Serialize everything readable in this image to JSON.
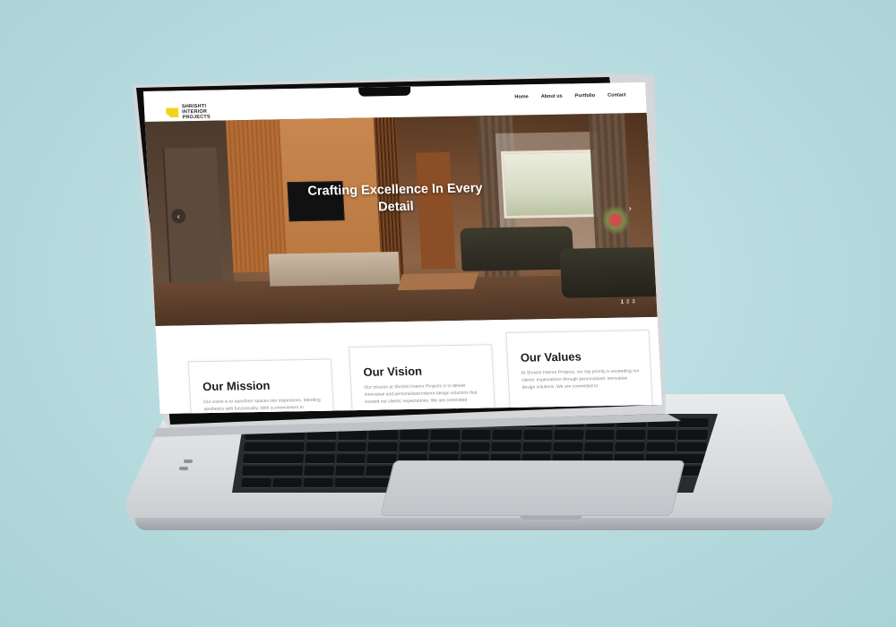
{
  "site": {
    "logo": {
      "line1": "SHRISHTI",
      "line2": "INTERIOR PROJECTS"
    },
    "nav": [
      "Home",
      "About us",
      "Portfolio",
      "Contact"
    ]
  },
  "hero": {
    "title": "Crafting Excellence In Every Detail",
    "prev_arrow": "‹",
    "next_arrow": "›",
    "dots": [
      "1",
      "2",
      "3"
    ]
  },
  "cards": [
    {
      "title": "Our Mission",
      "text": "Our vision is to transform spaces into inspirations, blending aesthetics with functionality. With a commitment to excellence and client satisfaction, we"
    },
    {
      "title": "Our Vision",
      "text": "Our mission at Shrishti Interior Projects is to deliver innovative and personalized interior design solutions that exceed our clients' expectations. We are committed"
    },
    {
      "title": "Our Values",
      "text": "At Shrishti Interior Projects, our top priority is exceeding our clients' expectations through personalized, innovative design solutions. We are committed to"
    }
  ],
  "colors": {
    "background": "#b5dade",
    "accent": "#f2d31b",
    "laptop": "#d7d9dc",
    "bezel": "#0c0c0d"
  }
}
